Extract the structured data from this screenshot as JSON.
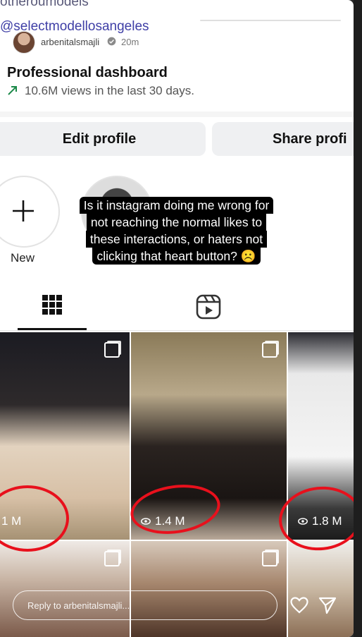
{
  "overlay_top": {
    "cut_line_1": "otheroumodels",
    "cut_line_2": "@selectmodellosangeles"
  },
  "header": {
    "username": "arbenitalsmajli",
    "time_ago": "20m",
    "play_icon": "play-icon",
    "more_icon": "more-icon",
    "verified_icon": "verified-badge-icon"
  },
  "dashboard": {
    "title": "Professional dashboard",
    "stat": "10.6M views in the last 30 days.",
    "trend_icon": "trending-up-icon",
    "accent": "#1d8a4a"
  },
  "buttons": {
    "edit_profile": "Edit profile",
    "share_profile": "Share profi"
  },
  "highlights": {
    "new_label": "New"
  },
  "caption": {
    "lines": [
      "Is it instagram doing me wrong for",
      "not reaching the normal likes to",
      "these interactions, or haters not",
      "clicking that heart button? ☹️"
    ]
  },
  "tabs": {
    "grid_icon": "grid-icon",
    "reels_icon": "reels-icon"
  },
  "posts": [
    {
      "views": "1 M"
    },
    {
      "views": "1.4 M"
    },
    {
      "views": "1.8 M"
    }
  ],
  "reply": {
    "placeholder": "Reply to arbenitalsmajli..."
  },
  "colors": {
    "annotation_red": "#e8101c",
    "button_bg": "#eff0f2"
  }
}
